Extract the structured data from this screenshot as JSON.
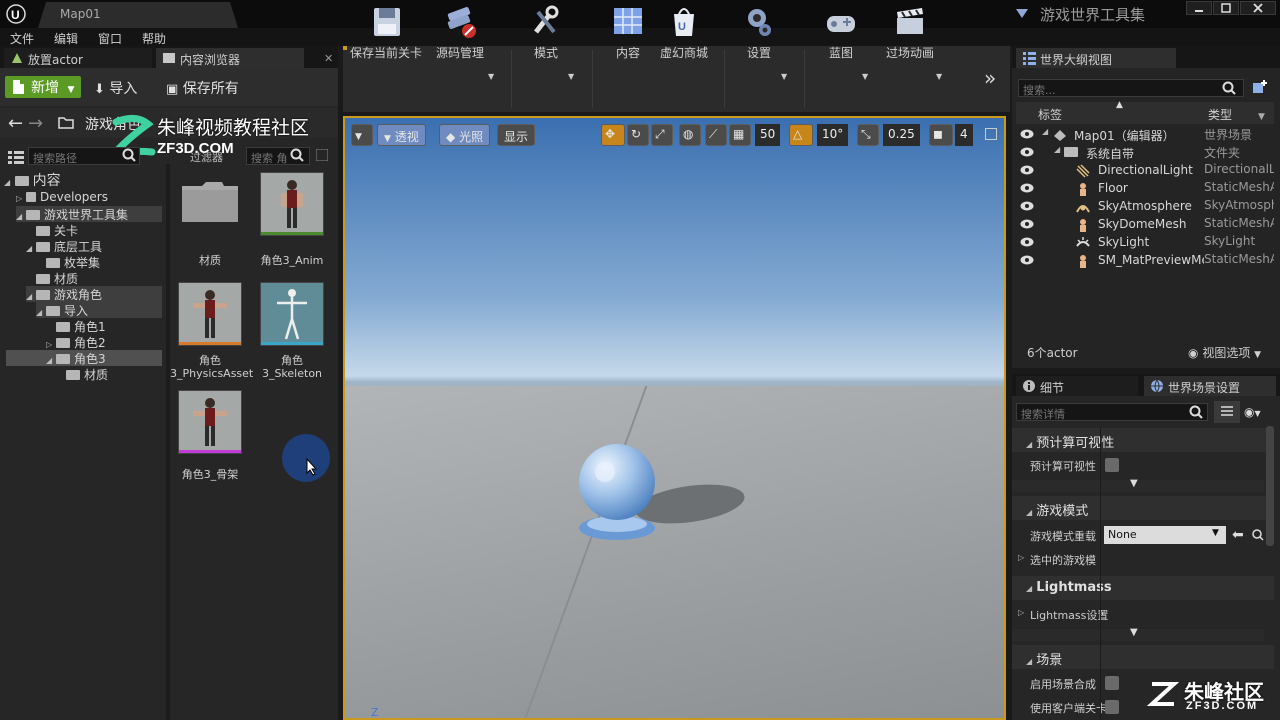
{
  "titlebar": {
    "map_tab": "Map01",
    "app_title": "游戏世界工具集"
  },
  "menu": [
    "文件",
    "编辑",
    "窗口",
    "帮助"
  ],
  "tabs": {
    "place_actor": "放置actor",
    "content_browser": "内容浏览器",
    "outliner": "世界大纲视图",
    "details": "细节",
    "world_settings": "世界场景设置"
  },
  "content_browser": {
    "add_label": "新增",
    "import_label": "导入",
    "save_all_label": "保存所有",
    "breadcrumb": "游戏角色",
    "search_path_placeholder": "搜索路径",
    "filter_label": "过滤器",
    "search_assets_placeholder": "搜索 角",
    "tree": [
      {
        "label": "内容",
        "level": 0,
        "selected": false
      },
      {
        "label": "Developers",
        "level": 1,
        "selected": false
      },
      {
        "label": "游戏世界工具集",
        "level": 1,
        "selected": true
      },
      {
        "label": "关卡",
        "level": 2,
        "selected": false
      },
      {
        "label": "底层工具",
        "level": 2,
        "selected": false
      },
      {
        "label": "枚举集",
        "level": 3,
        "selected": false
      },
      {
        "label": "材质",
        "level": 2,
        "selected": false
      },
      {
        "label": "游戏角色",
        "level": 2,
        "selected": true
      },
      {
        "label": "导入",
        "level": 3,
        "selected": true
      },
      {
        "label": "角色1",
        "level": 4,
        "selected": false
      },
      {
        "label": "角色2",
        "level": 4,
        "selected": false
      },
      {
        "label": "角色3",
        "level": 4,
        "selected": true
      },
      {
        "label": "材质",
        "level": 5,
        "selected": false
      }
    ],
    "assets": [
      {
        "label": "材质",
        "kind": "folder"
      },
      {
        "label": "角色3_Anim",
        "kind": "character",
        "bar_color": "#4b8a2f"
      },
      {
        "label": "角色3_PhysicsAsset",
        "kind": "character",
        "bar_color": "#d47a2a"
      },
      {
        "label": "角色3_Skeleton",
        "kind": "skeleton",
        "bar_color": "#3aa6c8"
      },
      {
        "label": "角色3_骨架",
        "kind": "character",
        "bar_color": "#c23bd6"
      }
    ]
  },
  "watermark": {
    "text": "朱峰视频教程社区",
    "url": "ZF3D.COM",
    "corner_text": "朱峰社区",
    "corner_url": "ZF3D.COM"
  },
  "main_toolbar": [
    {
      "label": "保存当前关卡",
      "icon": "save-icon"
    },
    {
      "label": "源码管理",
      "icon": "source-control-icon"
    },
    {
      "label": "模式",
      "icon": "modes-icon"
    },
    {
      "label": "内容",
      "icon": "content-icon"
    },
    {
      "label": "虚幻商城",
      "icon": "marketplace-icon"
    },
    {
      "label": "设置",
      "icon": "settings-icon"
    },
    {
      "label": "蓝图",
      "icon": "blueprint-icon"
    },
    {
      "label": "过场动画",
      "icon": "cinematics-icon"
    }
  ],
  "viewport": {
    "perspective_label": "透视",
    "lighting_label": "光照",
    "show_label": "显示",
    "grid_snap": "50",
    "rotation_snap": "10°",
    "scale_snap": "0.25",
    "camera_speed": "4",
    "axis_label": "Z"
  },
  "outliner": {
    "search_placeholder": "搜索...",
    "col_label": "标签",
    "col_type": "类型",
    "rows": [
      {
        "label": "Map01（编辑器）",
        "type": "世界场景",
        "indent": 1
      },
      {
        "label": "系统自带",
        "type": "文件夹",
        "indent": 2
      },
      {
        "label": "DirectionalLight",
        "type": "DirectionalLi",
        "indent": 3
      },
      {
        "label": "Floor",
        "type": "StaticMeshA",
        "indent": 3
      },
      {
        "label": "SkyAtmosphere",
        "type": "SkyAtmosph",
        "indent": 3
      },
      {
        "label": "SkyDomeMesh",
        "type": "StaticMeshA",
        "indent": 3
      },
      {
        "label": "SkyLight",
        "type": "SkyLight",
        "indent": 3
      },
      {
        "label": "SM_MatPreviewMesh",
        "type": "StaticMeshA",
        "indent": 3
      }
    ],
    "actor_count": "6个actor",
    "view_options": "视图选项"
  },
  "details": {
    "search_placeholder": "搜索详情",
    "precomputed_visibility_cat": "预计算可视性",
    "precomputed_visibility_prop": "预计算可视性",
    "game_mode_cat": "游戏模式",
    "game_mode_override": "游戏模式重载",
    "game_mode_value": "None",
    "selected_game_mode": "选中的游戏模",
    "lightmass_cat": "Lightmass",
    "lightmass_settings": "Lightmass设置",
    "scene_cat": "场景",
    "enable_scene_comp": "启用场景合成",
    "use_client_side": "使用客户端关卡"
  }
}
